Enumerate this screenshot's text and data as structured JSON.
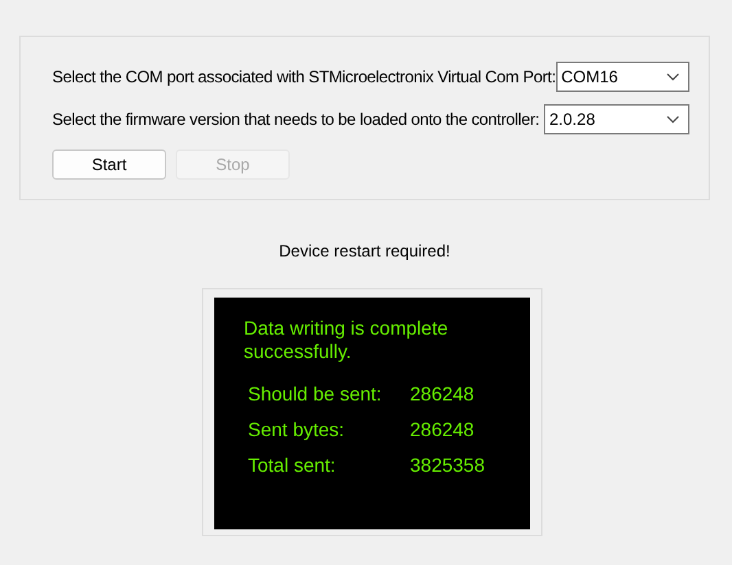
{
  "settings": {
    "rows": [
      {
        "label": "Select the COM port associated with STMicroelectronix Virtual Com Port:",
        "value": "COM16"
      },
      {
        "label": "Select the firmware version that needs to be loaded onto the controller:",
        "value": "2.0.28"
      }
    ],
    "buttons": [
      {
        "label": "Start",
        "disabled": false
      },
      {
        "label": "Stop",
        "disabled": true
      }
    ]
  },
  "message": "Device restart required!",
  "console": {
    "status": "Data writing is complete successfully.",
    "stats": [
      {
        "label": "Should be sent:",
        "value": "286248"
      },
      {
        "label": "Sent bytes:",
        "value": "286248"
      },
      {
        "label": "Total sent:",
        "value": "3825358"
      }
    ]
  }
}
